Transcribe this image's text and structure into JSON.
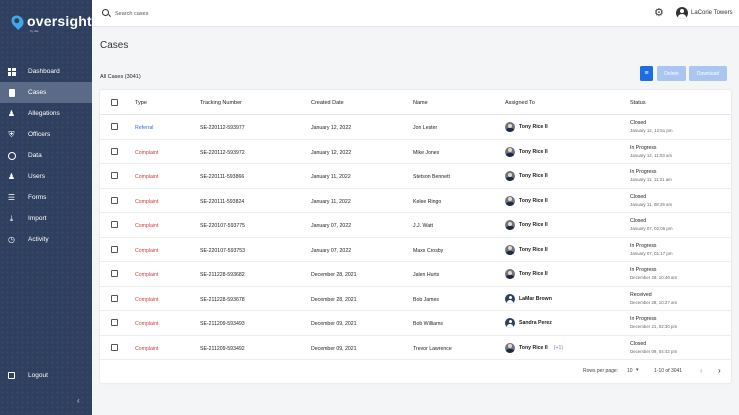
{
  "sidebar": {
    "logo_text": "oversight",
    "logo_sub": "by dsk",
    "items": [
      {
        "label": "Dashboard",
        "icon": "dashboard-icon"
      },
      {
        "label": "Cases",
        "icon": "document-icon",
        "active": true
      },
      {
        "label": "Allegations",
        "icon": "people-add-icon"
      },
      {
        "label": "Officers",
        "icon": "shield-icon"
      },
      {
        "label": "Data",
        "icon": "chart-ring-icon"
      },
      {
        "label": "Users",
        "icon": "users-icon"
      },
      {
        "label": "Forms",
        "icon": "list-icon"
      },
      {
        "label": "Import",
        "icon": "download-icon"
      },
      {
        "label": "Activity",
        "icon": "history-icon"
      }
    ],
    "logout_label": "Logout",
    "collapse_glyph": "‹"
  },
  "topbar": {
    "search_placeholder": "Search cases",
    "user_name": "LaCorie Towers"
  },
  "page": {
    "title": "Cases",
    "all_cases_label": "All Cases (3041)",
    "delete_label": "Delete",
    "download_label": "Download"
  },
  "table": {
    "headers": [
      "Type",
      "Tracking Number",
      "Created Date",
      "Name",
      "Assigned To",
      "Status"
    ],
    "rows": [
      {
        "type": "Referral",
        "tracking": "SE-220112-593977",
        "created": "January 12, 2022",
        "name": "Jon Lester",
        "assignee": "Tony Rice II",
        "avatar": "photo",
        "extra": "",
        "status": "Closed",
        "status_date": "January 12, 12:51 pm"
      },
      {
        "type": "Complaint",
        "tracking": "SE-220112-593972",
        "created": "January 12, 2022",
        "name": "Mike Jones",
        "assignee": "Tony Rice II",
        "avatar": "photo",
        "extra": "",
        "status": "In Progress",
        "status_date": "January 12, 11:53 am"
      },
      {
        "type": "Complaint",
        "tracking": "SE-220111-593866",
        "created": "January 11, 2022",
        "name": "Stetson Bennett",
        "assignee": "Tony Rice II",
        "avatar": "photo",
        "extra": "",
        "status": "In Progress",
        "status_date": "January 11, 11:21 am"
      },
      {
        "type": "Complaint",
        "tracking": "SE-220111-593824",
        "created": "January 11, 2022",
        "name": "Kelee Ringo",
        "assignee": "Tony Rice II",
        "avatar": "photo",
        "extra": "",
        "status": "Closed",
        "status_date": "January 11, 08:29 am"
      },
      {
        "type": "Complaint",
        "tracking": "SE-220107-593775",
        "created": "January 07, 2022",
        "name": "J.J. Watt",
        "assignee": "Tony Rice II",
        "avatar": "photo",
        "extra": "",
        "status": "Closed",
        "status_date": "January 07, 02:06 pm"
      },
      {
        "type": "Complaint",
        "tracking": "SE-220107-593753",
        "created": "January 07, 2022",
        "name": "Maxx Crosby",
        "assignee": "Tony Rice II",
        "avatar": "photo",
        "extra": "",
        "status": "In Progress",
        "status_date": "January 07, 01:17 pm"
      },
      {
        "type": "Complaint",
        "tracking": "SE-211228-593682",
        "created": "December 28, 2021",
        "name": "Jalen Hurts",
        "assignee": "Tony Rice II",
        "avatar": "photo",
        "extra": "",
        "status": "In Progress",
        "status_date": "December 28, 10:46 am"
      },
      {
        "type": "Complaint",
        "tracking": "SE-211228-593678",
        "created": "December 28, 2021",
        "name": "Bob James",
        "assignee": "LaMar Brown",
        "avatar": "generic",
        "extra": "",
        "status": "Received",
        "status_date": "December 28, 10:27 am"
      },
      {
        "type": "Complaint",
        "tracking": "SE-211209-593493",
        "created": "December 09, 2021",
        "name": "Bob Williams",
        "assignee": "Sandra Perez",
        "avatar": "generic",
        "extra": "",
        "status": "In Progress",
        "status_date": "December 21, 02:30 pm"
      },
      {
        "type": "Complaint",
        "tracking": "SE-211209-593492",
        "created": "December 09, 2021",
        "name": "Trevor Lawrence",
        "assignee": "Tony Rice II",
        "avatar": "photo",
        "extra": "(+1)",
        "status": "Closed",
        "status_date": "December 09, 04:42 pm"
      }
    ]
  },
  "footer": {
    "rows_per_page_label": "Rows per page:",
    "rows_per_page_value": "10",
    "range": "1-10 of 3041"
  },
  "colors": {
    "sidebar_bg": "#2f3f5f",
    "primary": "#1b6de0",
    "referral": "#2e6fd1",
    "complaint": "#d23b3b"
  }
}
